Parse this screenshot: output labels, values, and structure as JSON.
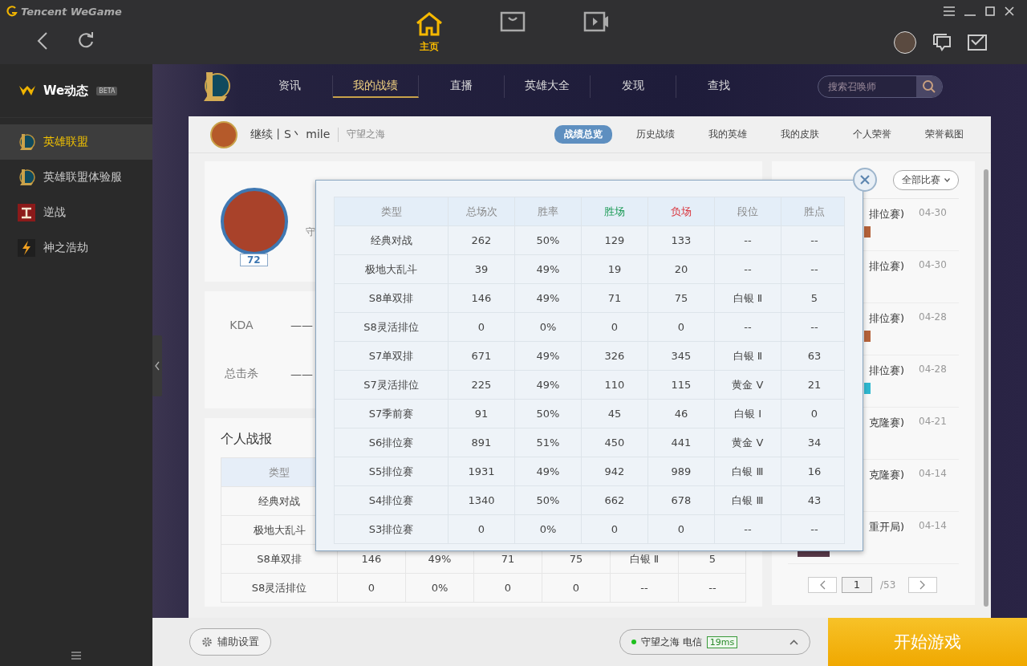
{
  "window": {
    "title": "Tencent WeGame"
  },
  "top_tabs": [
    {
      "kind": "home",
      "label": "主页",
      "selected": true
    },
    {
      "kind": "store",
      "selected": false
    },
    {
      "kind": "video",
      "selected": false
    }
  ],
  "sidebar": {
    "header": {
      "title": "We动态",
      "badge": "BETA"
    },
    "items": [
      {
        "kind": "lol",
        "label": "英雄联盟",
        "selected": true
      },
      {
        "kind": "lol",
        "label": "英雄联盟体验服",
        "selected": false
      },
      {
        "kind": "nz",
        "label": "逆战",
        "selected": false
      },
      {
        "kind": "bolt",
        "label": "神之浩劫",
        "selected": false
      }
    ]
  },
  "game_nav": {
    "tabs": [
      {
        "label": "资讯",
        "selected": false
      },
      {
        "label": "我的战绩",
        "selected": true
      },
      {
        "label": "直播",
        "selected": false
      },
      {
        "label": "英雄大全",
        "selected": false
      },
      {
        "label": "发现",
        "selected": false
      },
      {
        "label": "查找",
        "selected": false
      }
    ],
    "search": {
      "placeholder": "搜索召唤师"
    }
  },
  "header": {
    "summoner": "继续丨S丶 mile",
    "server": "守望之海"
  },
  "sub_tabs": [
    {
      "label": "战绩总览",
      "selected": true
    },
    {
      "label": "历史战绩",
      "selected": false
    },
    {
      "label": "我的英雄",
      "selected": false
    },
    {
      "label": "我的皮肤",
      "selected": false
    },
    {
      "label": "个人荣誉",
      "selected": false
    },
    {
      "label": "荣誉截图",
      "selected": false
    }
  ],
  "profile_card": {
    "server": "守",
    "level": "72"
  },
  "stats": [
    {
      "label": "KDA",
      "value": "——"
    },
    {
      "label": "总击杀",
      "value": "——"
    }
  ],
  "report": {
    "title": "个人战报",
    "columns": [
      "类型"
    ],
    "rows": [
      [
        "经典对战"
      ],
      [
        "极地大乱斗"
      ],
      [
        "S8单双排",
        "146",
        "49%",
        "71",
        "75",
        "白银 Ⅱ",
        "5"
      ],
      [
        "S8灵活排位",
        "0",
        "0%",
        "0",
        "0",
        "--",
        "--"
      ]
    ]
  },
  "recent": {
    "filter": "全部比赛",
    "matches": [
      {
        "mode": "排位赛)",
        "date": "04-30",
        "color": "#b5623a"
      },
      {
        "mode": "排位赛)",
        "date": "04-30"
      },
      {
        "mode": "排位赛)",
        "date": "04-28",
        "color": "#b5623a"
      },
      {
        "mode": "排位赛)",
        "date": "04-28",
        "color": "#2fb8d0"
      },
      {
        "mode": "克隆赛)",
        "date": "04-21"
      },
      {
        "mode": "克隆赛)",
        "date": "04-14"
      },
      {
        "mode": "重开局)",
        "date": "04-14"
      }
    ],
    "pager": {
      "page": "1",
      "total": "/53"
    }
  },
  "popup": {
    "columns": [
      {
        "label": "类型"
      },
      {
        "label": "总场次"
      },
      {
        "label": "胜率"
      },
      {
        "label": "胜场",
        "color": "#1a9a55"
      },
      {
        "label": "负场",
        "color": "#d9363e"
      },
      {
        "label": "段位"
      },
      {
        "label": "胜点"
      }
    ],
    "rows": [
      [
        "经典对战",
        "262",
        "50%",
        "129",
        "133",
        "--",
        "--"
      ],
      [
        "极地大乱斗",
        "39",
        "49%",
        "19",
        "20",
        "--",
        "--"
      ],
      [
        "S8单双排",
        "146",
        "49%",
        "71",
        "75",
        "白银 Ⅱ",
        "5"
      ],
      [
        "S8灵活排位",
        "0",
        "0%",
        "0",
        "0",
        "--",
        "--"
      ],
      [
        "S7单双排",
        "671",
        "49%",
        "326",
        "345",
        "白银 Ⅱ",
        "63"
      ],
      [
        "S7灵活排位",
        "225",
        "49%",
        "110",
        "115",
        "黄金 Ⅴ",
        "21"
      ],
      [
        "S7季前赛",
        "91",
        "50%",
        "45",
        "46",
        "白银 Ⅰ",
        "0"
      ],
      [
        "S6排位赛",
        "891",
        "51%",
        "450",
        "441",
        "黄金 Ⅴ",
        "34"
      ],
      [
        "S5排位赛",
        "1931",
        "49%",
        "942",
        "989",
        "白银 Ⅲ",
        "16"
      ],
      [
        "S4排位赛",
        "1340",
        "50%",
        "662",
        "678",
        "白银 Ⅲ",
        "43"
      ],
      [
        "S3排位赛",
        "0",
        "0%",
        "0",
        "0",
        "--",
        "--"
      ]
    ]
  },
  "bottom": {
    "assist": "辅助设置",
    "server": {
      "name": "守望之海 电信",
      "ping": "19ms",
      "online": true
    },
    "start": "开始游戏"
  }
}
